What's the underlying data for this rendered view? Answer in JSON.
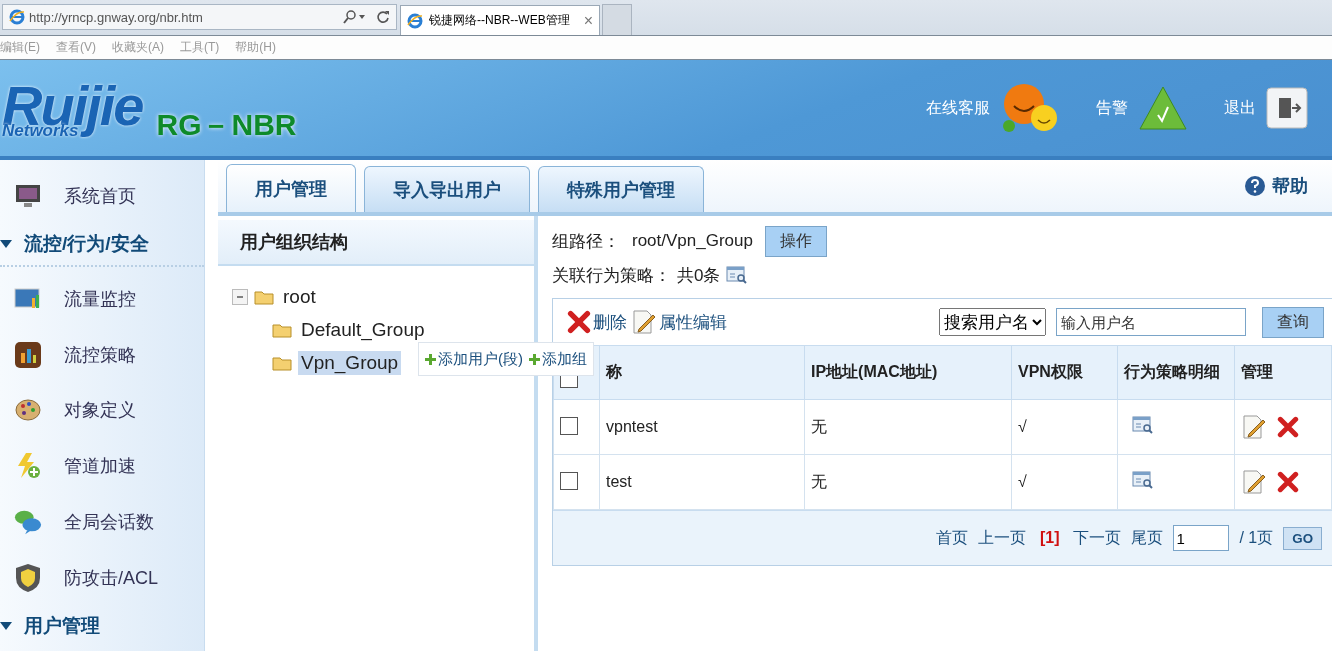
{
  "browser": {
    "url": "http://yrncp.gnway.org/nbr.htm",
    "tab_title": "锐捷网络--NBR--WEB管理",
    "tab_close": "×",
    "menu": [
      "编辑(E)",
      "查看(V)",
      "收藏夹(A)",
      "工具(T)",
      "帮助(H)"
    ]
  },
  "header": {
    "logo": "Ruijie",
    "logo_sub": "Networks",
    "product": "RG－NBR",
    "actions": [
      "在线客服",
      "告警",
      "退出"
    ]
  },
  "sidebar": {
    "items": [
      {
        "kind": "link",
        "label": "系统首页"
      },
      {
        "kind": "section",
        "label": "流控/行为/安全",
        "expanded": true
      },
      {
        "kind": "link",
        "label": "流量监控"
      },
      {
        "kind": "link",
        "label": "流控策略"
      },
      {
        "kind": "link",
        "label": "对象定义"
      },
      {
        "kind": "link",
        "label": "管道加速"
      },
      {
        "kind": "link",
        "label": "全局会话数"
      },
      {
        "kind": "link",
        "label": "防攻击/ACL"
      },
      {
        "kind": "section",
        "label": "用户管理",
        "expanded": true
      }
    ]
  },
  "tabs": [
    {
      "label": "用户管理",
      "selected": true
    },
    {
      "label": "导入导出用户",
      "selected": false
    },
    {
      "label": "特殊用户管理",
      "selected": false
    }
  ],
  "help": "帮助",
  "tree": {
    "title": "用户组织结构",
    "nodes": [
      {
        "label": "root",
        "expanded": true,
        "selected": false,
        "children": [
          {
            "label": "Default_Group",
            "selected": false
          },
          {
            "label": "Vpn_Group",
            "selected": true
          }
        ]
      }
    ],
    "popup": [
      "添加用户(段)",
      "添加组"
    ]
  },
  "detail": {
    "path_label": "组路径：",
    "path": "root/Vpn_Group",
    "action_button": "操作",
    "policy_label": "关联行为策略：",
    "policy_count": "共0条"
  },
  "toolbar": {
    "delete": "删除",
    "edit": "属性编辑",
    "search_select": "搜索用户名",
    "search_placeholder": "输入用户名",
    "query": "查询"
  },
  "table": {
    "all_checked": false,
    "columns": [
      "称",
      "IP地址(MAC地址)",
      "VPN权限",
      "行为策略明细",
      "管理"
    ],
    "rows": [
      {
        "checked": false,
        "name": "vpntest",
        "ip": "无",
        "vpn": "√"
      },
      {
        "checked": false,
        "name": "test",
        "ip": "无",
        "vpn": "√"
      }
    ]
  },
  "pager": {
    "first": "首页",
    "prev": "上一页",
    "current": "[1]",
    "next": "下一页",
    "last": "尾页",
    "page_value": "1",
    "total": "/ 1页",
    "go": "GO"
  }
}
